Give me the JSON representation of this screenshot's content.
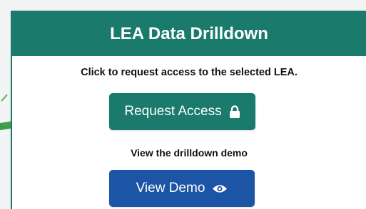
{
  "card": {
    "title": "LEA Data Drilldown",
    "access_instruction": "Click to request access to the selected LEA.",
    "request_button_label": "Request Access",
    "demo_instruction": "View the drilldown demo",
    "demo_button_label": "View Demo"
  },
  "icons": {
    "request": "lock-icon",
    "demo": "eye-icon",
    "pointer": "curved-arrow-icon"
  },
  "colors": {
    "teal": "#1a7a6c",
    "blue": "#1c54a6",
    "arrow_green": "#5cb84a"
  }
}
